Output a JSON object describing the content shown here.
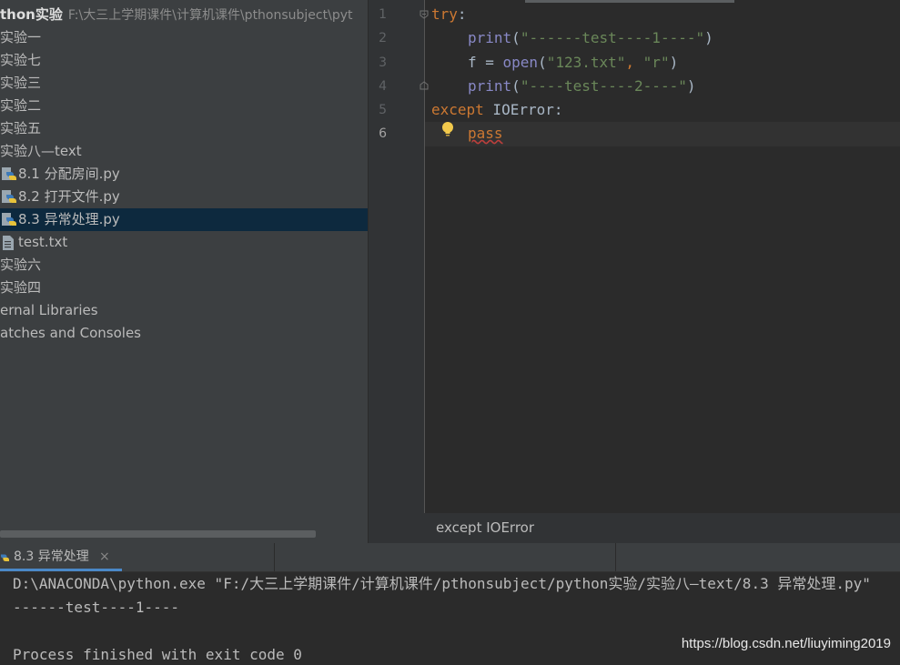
{
  "project": {
    "root_name": "thon实验",
    "root_path": "F:\\大三上学期课件\\计算机课件\\pthonsubject\\pyt",
    "items": [
      {
        "label": "实验一"
      },
      {
        "label": "实验七"
      },
      {
        "label": "实验三"
      },
      {
        "label": "实验二"
      },
      {
        "label": "实验五"
      },
      {
        "label": "实验八—text"
      },
      {
        "label": "8.1 分配房间.py"
      },
      {
        "label": "8.2 打开文件.py"
      },
      {
        "label": "8.3 异常处理.py"
      },
      {
        "label": "test.txt"
      },
      {
        "label": "实验六"
      },
      {
        "label": "实验四"
      },
      {
        "label": "ernal Libraries"
      },
      {
        "label": "atches and Consoles"
      }
    ]
  },
  "editor": {
    "line_numbers": [
      "1",
      "2",
      "3",
      "4",
      "5",
      "6"
    ],
    "lines": {
      "l1_kw": "try",
      "l1_colon": ":",
      "l2_fn": "print",
      "l2_open": "(",
      "l2_str": "\"------test----1----\"",
      "l2_close": ")",
      "l3_var": "f = ",
      "l3_fn": "open",
      "l3_open": "(",
      "l3_str1": "\"123.txt\"",
      "l3_comma": ", ",
      "l3_str2": "\"r\"",
      "l3_close": ")",
      "l4_fn": "print",
      "l4_open": "(",
      "l4_str": "\"----test----2----\"",
      "l4_close": ")",
      "l5_kw": "except",
      "l5_exc": " IOError",
      "l5_colon": ":",
      "l6_kw": "pass"
    }
  },
  "breadcrumb": {
    "text": "except IOError"
  },
  "run": {
    "tab_label": "8.3 异常处理",
    "close_glyph": "×",
    "output": [
      "D:\\ANACONDA\\python.exe \"F:/大三上学期课件/计算机课件/pthonsubject/python实验/实验八—text/8.3 异常处理.py\"",
      "------test----1----",
      "",
      "Process finished with exit code 0"
    ]
  },
  "watermark": "https://blog.csdn.net/liuyiming2019",
  "colors": {
    "keyword": "#cc7832",
    "builtin": "#8888c6",
    "string": "#6a8759",
    "selection": "#0d293e",
    "tab_accent": "#4a88c7"
  },
  "icons": {
    "python_file": "python-file-icon",
    "text_file": "text-file-icon",
    "bulb": "lightbulb-icon",
    "fold": "fold-marker-icon"
  }
}
